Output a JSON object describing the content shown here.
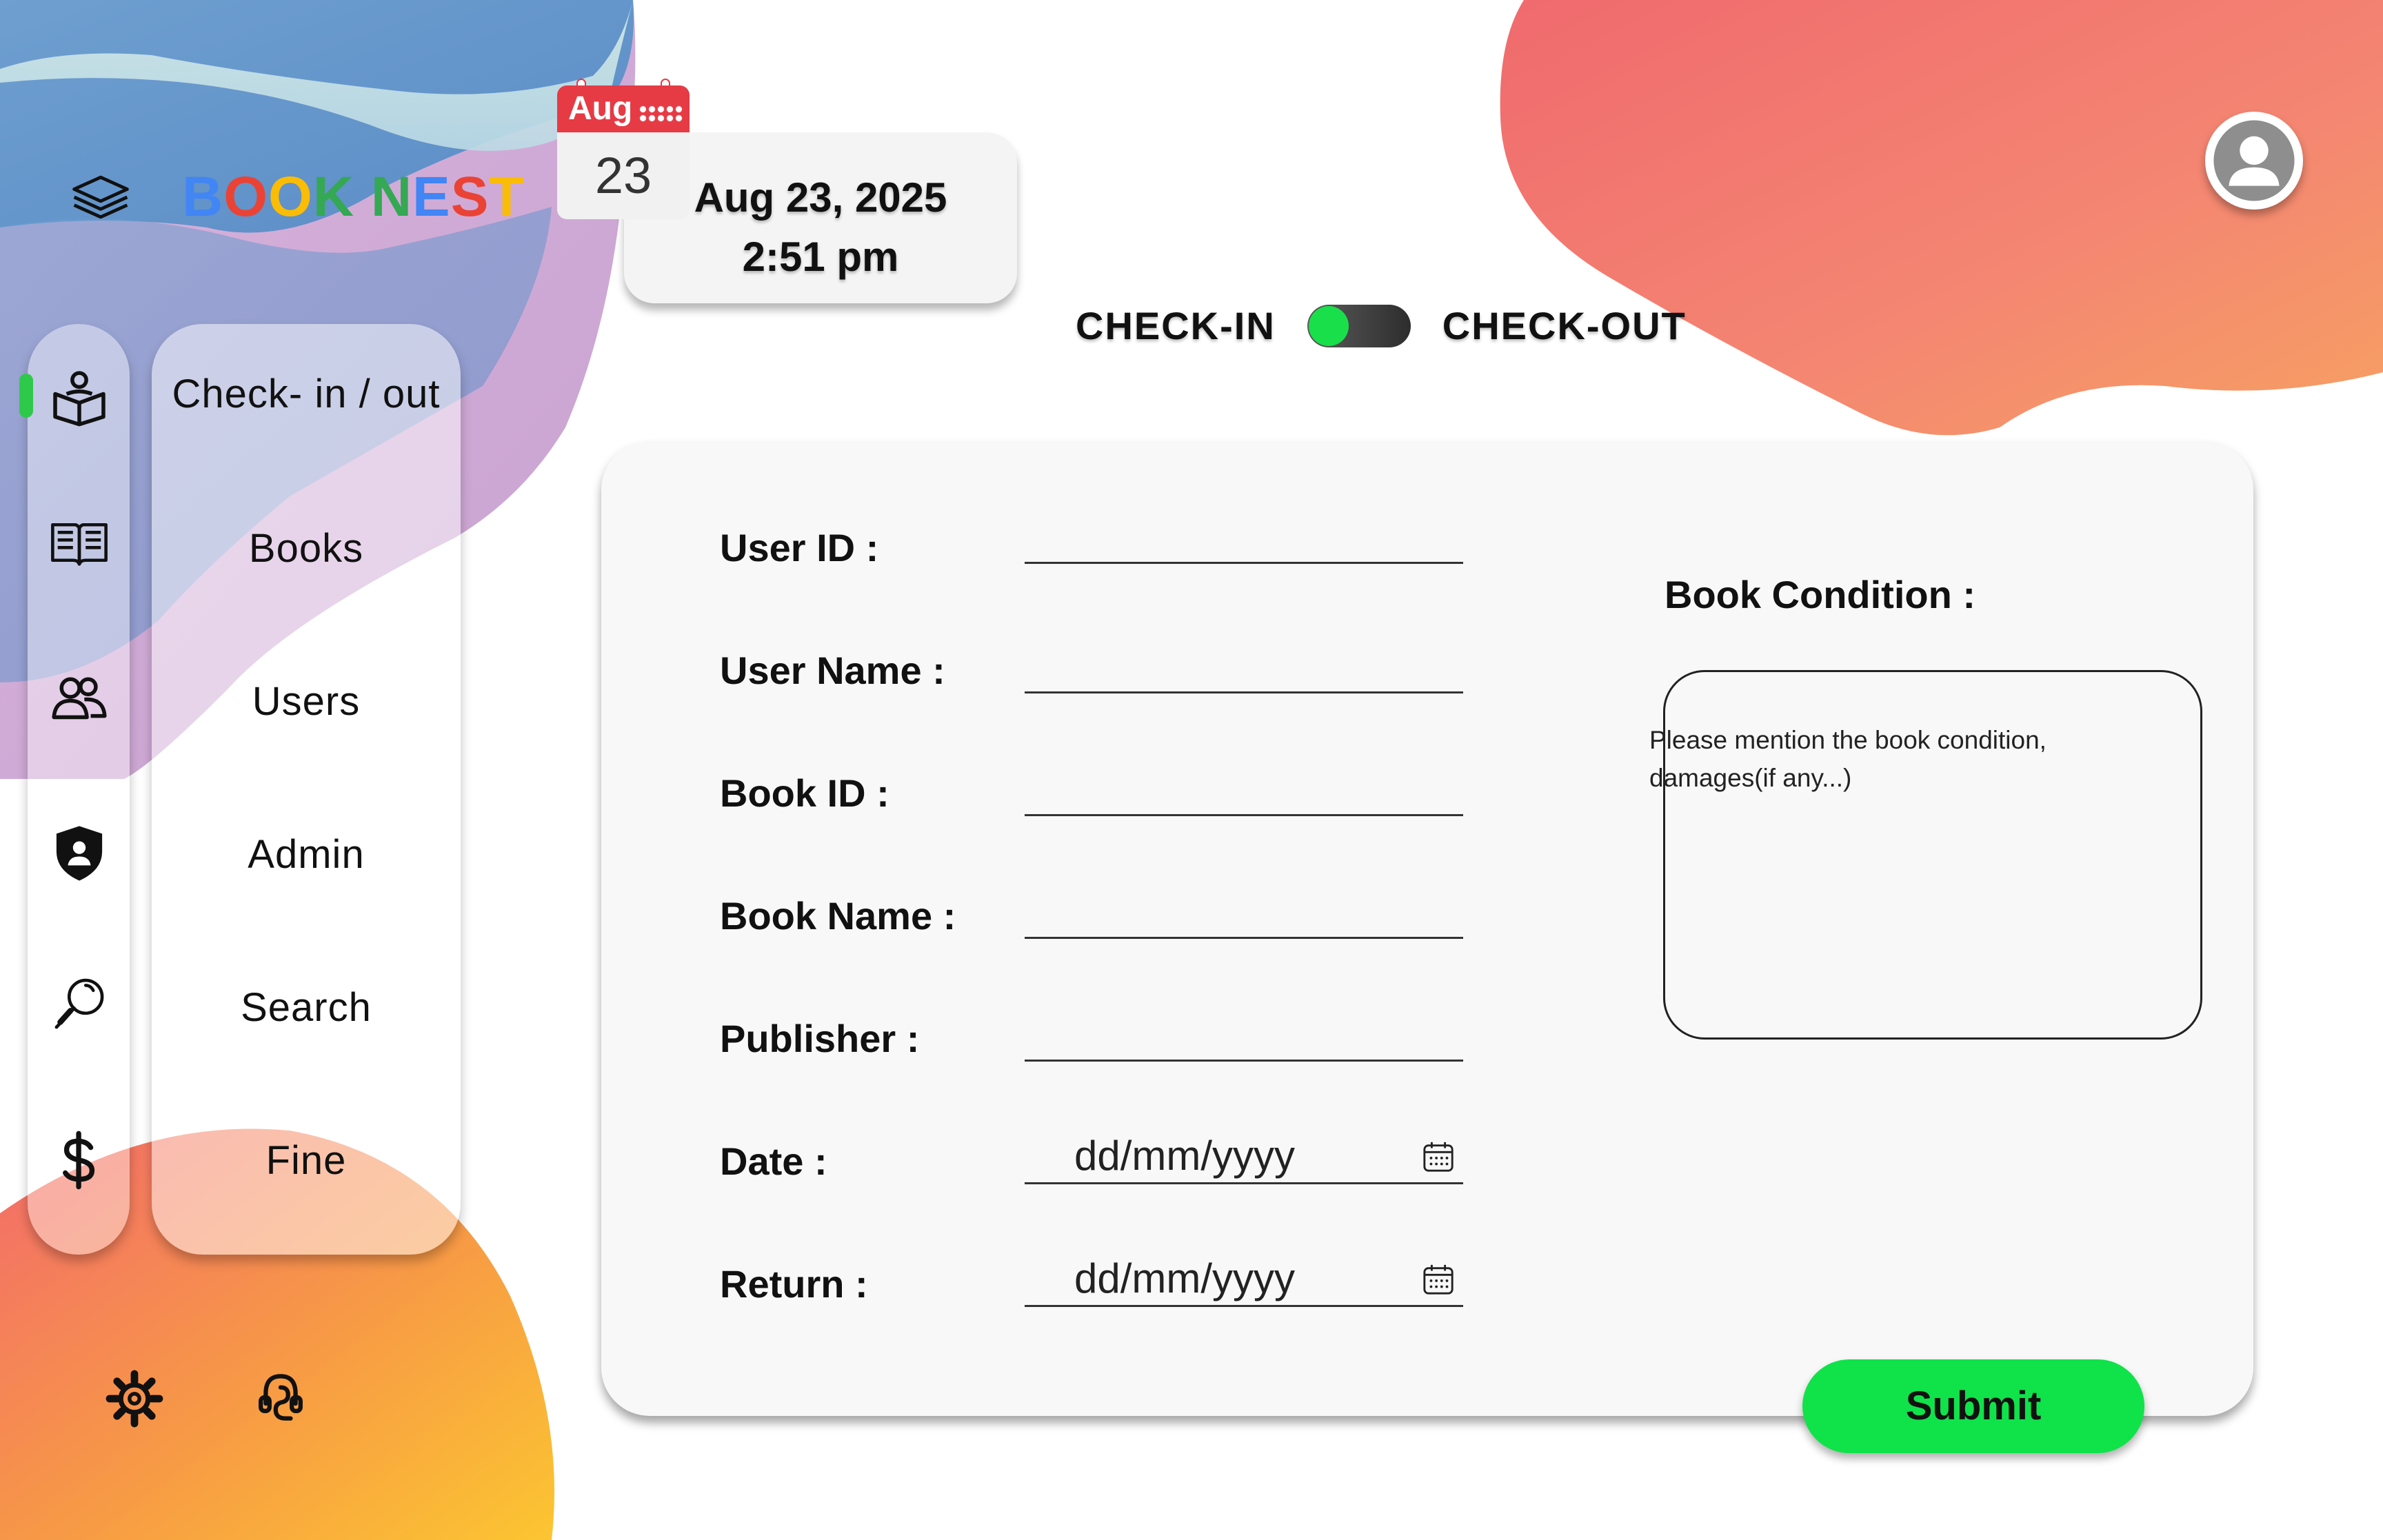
{
  "app": {
    "brand_letters": [
      {
        "ch": "B",
        "color": "#4285F4"
      },
      {
        "ch": "O",
        "color": "#EA4335"
      },
      {
        "ch": "O",
        "color": "#FBBC05"
      },
      {
        "ch": "K",
        "color": "#34A853"
      },
      {
        "ch": " ",
        "color": "#000000"
      },
      {
        "ch": "N",
        "color": "#34A853"
      },
      {
        "ch": "E",
        "color": "#4285F4"
      },
      {
        "ch": "S",
        "color": "#EA4335"
      },
      {
        "ch": "T",
        "color": "#FBBC05"
      }
    ],
    "brand_icon": "layers-icon"
  },
  "datetime": {
    "calendar_month": "Aug",
    "calendar_day": "23",
    "date": "Aug 23, 2025",
    "time": "2:51 pm"
  },
  "mode_toggle": {
    "left_label": "CHECK-IN",
    "right_label": "CHECK-OUT",
    "active": "CHECK-IN",
    "on_color": "#19e04a"
  },
  "sidebar": {
    "items": [
      {
        "label": "Check- in / out",
        "icon": "reader-book-icon",
        "active": true
      },
      {
        "label": "Books",
        "icon": "open-book-icon"
      },
      {
        "label": "Users",
        "icon": "users-icon"
      },
      {
        "label": "Admin",
        "icon": "shield-user-icon"
      },
      {
        "label": "Search",
        "icon": "magnifier-icon"
      },
      {
        "label": "Fine",
        "icon": "dollar-icon"
      }
    ],
    "bottom_icons": [
      "gear-icon",
      "support-icon"
    ],
    "active_color": "#2ec94a"
  },
  "form": {
    "fields": [
      {
        "label": "User ID :",
        "value": ""
      },
      {
        "label": "User Name :",
        "value": ""
      },
      {
        "label": "Book ID :",
        "value": ""
      },
      {
        "label": "Book Name :",
        "value": ""
      },
      {
        "label": "Publisher :",
        "value": ""
      },
      {
        "label": "Date :",
        "placeholder": "dd/mm/yyyy"
      },
      {
        "label": "Return :",
        "placeholder": "dd/mm/yyyy"
      }
    ],
    "condition_label": "Book Condition :",
    "condition_placeholder": "Please mention the book condition, damages(if any...)",
    "submit_label": "Submit",
    "submit_color": "#10e24a"
  }
}
